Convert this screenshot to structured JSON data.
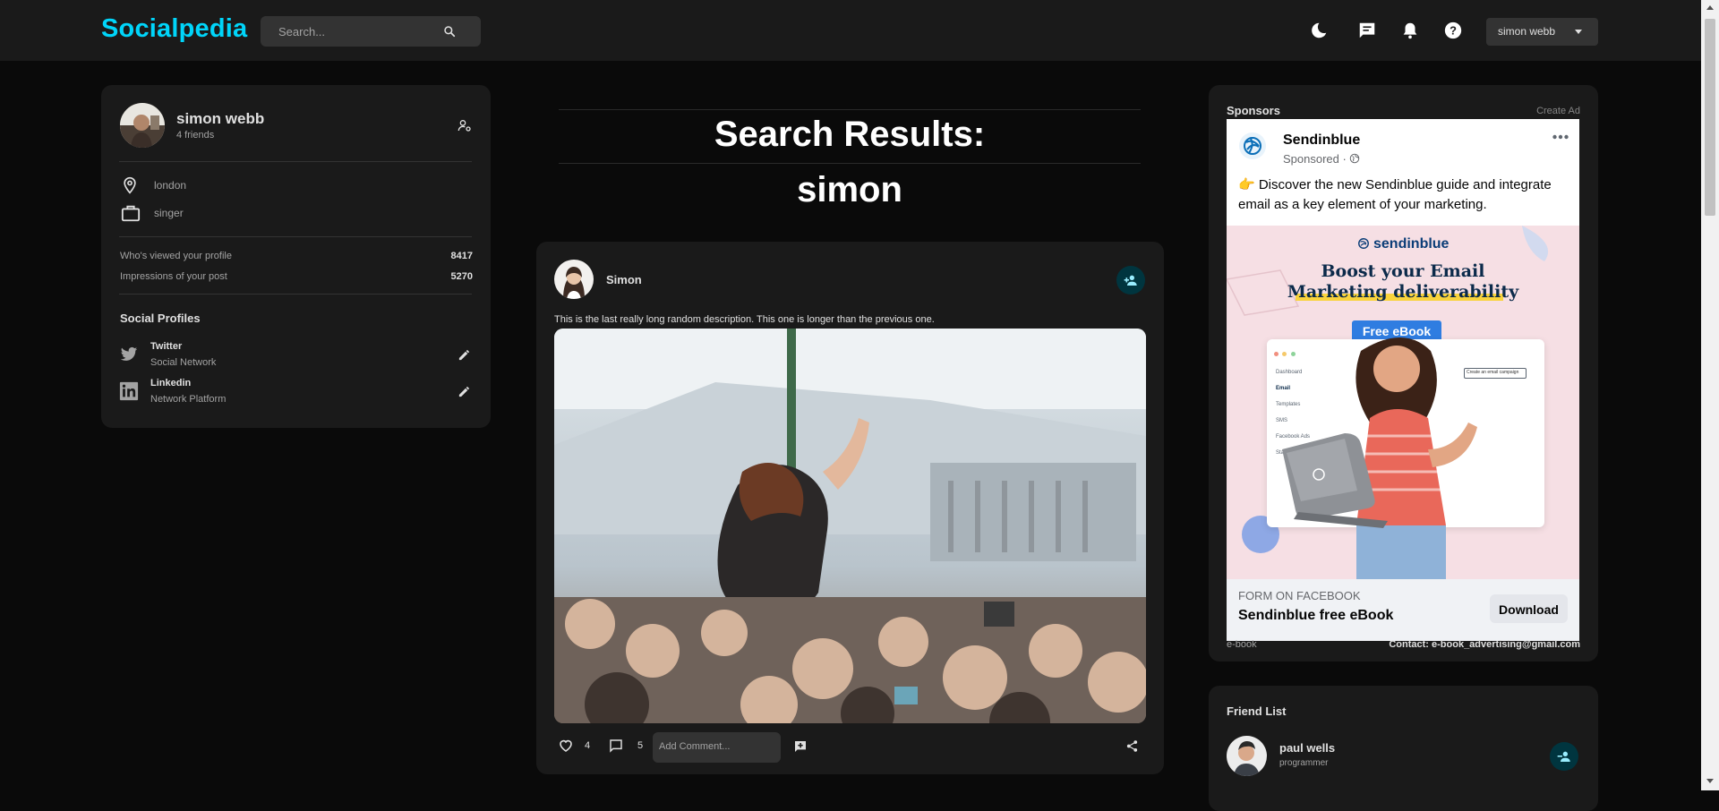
{
  "navbar": {
    "brand": "Socialpedia",
    "search_placeholder": "Search...",
    "user_name": "simon webb",
    "icons": [
      "search-icon",
      "dark-mode-icon",
      "message-icon",
      "notification-icon",
      "help-icon",
      "chevron-down-icon"
    ]
  },
  "profile": {
    "name": "simon webb",
    "friends": "4 friends",
    "location": "london",
    "occupation": "singer",
    "viewed_label": "Who's viewed your profile",
    "viewed_value": "8417",
    "impressions_label": "Impressions of your post",
    "impressions_value": "5270",
    "social_title": "Social Profiles",
    "socials": [
      {
        "name": "Twitter",
        "type": "Social Network"
      },
      {
        "name": "Linkedin",
        "type": "Network Platform"
      }
    ]
  },
  "results": {
    "title": "Search Results:",
    "query": "simon"
  },
  "post": {
    "author": "Simon",
    "description": "This is the last really long random description. This one is longer than the previous one.",
    "likes": "4",
    "comments": "5",
    "comment_placeholder": "Add Comment..."
  },
  "sponsor": {
    "title": "Sponsors",
    "create_ad": "Create Ad",
    "advertiser": "Sendinblue",
    "sponsored": "Sponsored · ",
    "text": "👉 Discover the new Sendinblue guide and integrate email as a key element of your marketing.",
    "logo_text": "sendinblue",
    "headline_1": "Boost your Email",
    "headline_2": "Marketing deliverability",
    "badge": "Free eBook",
    "form_label": "FORM ON FACEBOOK",
    "form_title": "Sendinblue free eBook",
    "download": "Download",
    "footer_left": "e-book",
    "footer_right": "Contact: e-book_advertising@gmail.com",
    "mock_menu": [
      "Dashboard",
      "Email",
      "Templates",
      "SMS",
      "Facebook Ads",
      "Statistics"
    ],
    "mock_button": "Create an email campaign"
  },
  "friends": {
    "title": "Friend List",
    "items": [
      {
        "name": "paul wells",
        "occupation": "programmer"
      }
    ]
  },
  "colors": {
    "accent": "#00d5fa",
    "card": "#1a1a1a",
    "background": "#0a0a0a",
    "circle_button": "#00353f"
  }
}
